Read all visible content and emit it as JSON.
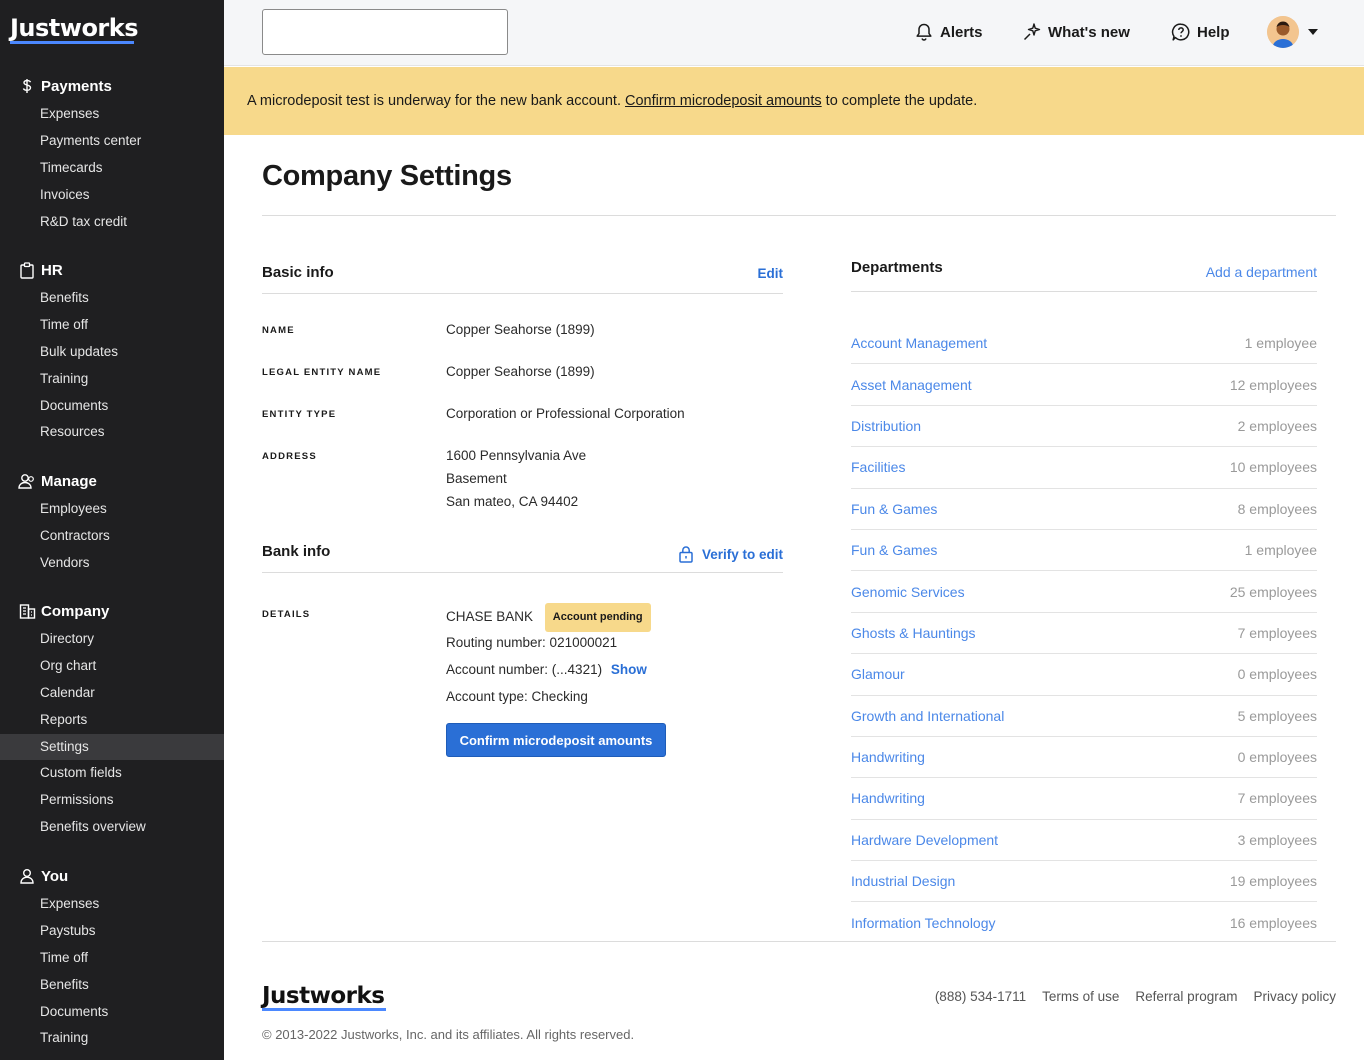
{
  "brand": "Justworks",
  "sidebar": {
    "sections": [
      {
        "title": "Payments",
        "icon": "dollar-icon",
        "items": [
          "Expenses",
          "Payments center",
          "Timecards",
          "Invoices",
          "R&D tax credit"
        ]
      },
      {
        "title": "HR",
        "icon": "clipboard-icon",
        "items": [
          "Benefits",
          "Time off",
          "Bulk updates",
          "Training",
          "Documents",
          "Resources"
        ]
      },
      {
        "title": "Manage",
        "icon": "people-icon",
        "items": [
          "Employees",
          "Contractors",
          "Vendors"
        ]
      },
      {
        "title": "Company",
        "icon": "building-icon",
        "items": [
          "Directory",
          "Org chart",
          "Calendar",
          "Reports",
          "Settings",
          "Custom fields",
          "Permissions",
          "Benefits overview"
        ]
      },
      {
        "title": "You",
        "icon": "person-icon",
        "items": [
          "Expenses",
          "Paystubs",
          "Time off",
          "Benefits",
          "Documents",
          "Training"
        ]
      }
    ],
    "active_item": "Settings"
  },
  "topbar": {
    "search_value": "",
    "alerts": "Alerts",
    "whats_new": "What's new",
    "help": "Help"
  },
  "banner": {
    "text_before": "A microdeposit test is underway for the new bank account. ",
    "link": "Confirm microdeposit amounts",
    "text_after": " to complete the update."
  },
  "page": {
    "title": "Company Settings"
  },
  "basic_info": {
    "title": "Basic info",
    "edit": "Edit",
    "fields": {
      "name_label": "NAME",
      "name_value": "Copper Seahorse (1899)",
      "legal_label": "LEGAL ENTITY NAME",
      "legal_value": "Copper Seahorse (1899)",
      "entity_label": "ENTITY TYPE",
      "entity_value": "Corporation or Professional Corporation",
      "address_label": "ADDRESS",
      "address_line1": "1600 Pennsylvania Ave",
      "address_line2": "Basement",
      "address_line3": "San mateo, CA 94402"
    }
  },
  "bank_info": {
    "title": "Bank info",
    "verify": "Verify to edit",
    "details_label": "DETAILS",
    "bank_name": "CHASE BANK",
    "badge": "Account pending",
    "routing": "Routing number: 021000021",
    "account": "Account number: (...4321)",
    "show": "Show",
    "account_type": "Account type: Checking",
    "confirm_button": "Confirm microdeposit amounts"
  },
  "departments": {
    "title": "Departments",
    "add": "Add a department",
    "rows": [
      {
        "name": "Account Management",
        "count": "1 employee"
      },
      {
        "name": "Asset Management",
        "count": "12 employees"
      },
      {
        "name": "Distribution",
        "count": "2 employees"
      },
      {
        "name": "Facilities",
        "count": "10 employees"
      },
      {
        "name": "Fun & Games",
        "count": "8 employees"
      },
      {
        "name": "Fun & Games",
        "count": "1 employee"
      },
      {
        "name": "Genomic Services",
        "count": "25 employees"
      },
      {
        "name": "Ghosts & Hauntings",
        "count": "7 employees"
      },
      {
        "name": "Glamour",
        "count": "0 employees"
      },
      {
        "name": "Growth and International",
        "count": "5 employees"
      },
      {
        "name": "Handwriting",
        "count": "0 employees"
      },
      {
        "name": "Handwriting",
        "count": "7 employees"
      },
      {
        "name": "Hardware Development",
        "count": "3 employees"
      },
      {
        "name": "Industrial Design",
        "count": "19 employees"
      },
      {
        "name": "Information Technology",
        "count": "16 employees"
      }
    ]
  },
  "footer": {
    "brand": "Justworks",
    "phone": "(888) 534-1711",
    "terms": "Terms of use",
    "referral": "Referral program",
    "privacy": "Privacy policy",
    "copyright": "© 2013-2022 Justworks, Inc. and its affiliates. All rights reserved."
  },
  "colors": {
    "sidebar_bg": "#1f1f21",
    "accent": "#2a6fd6",
    "banner_bg": "#f7d98b",
    "link_light": "#4b88e8"
  }
}
